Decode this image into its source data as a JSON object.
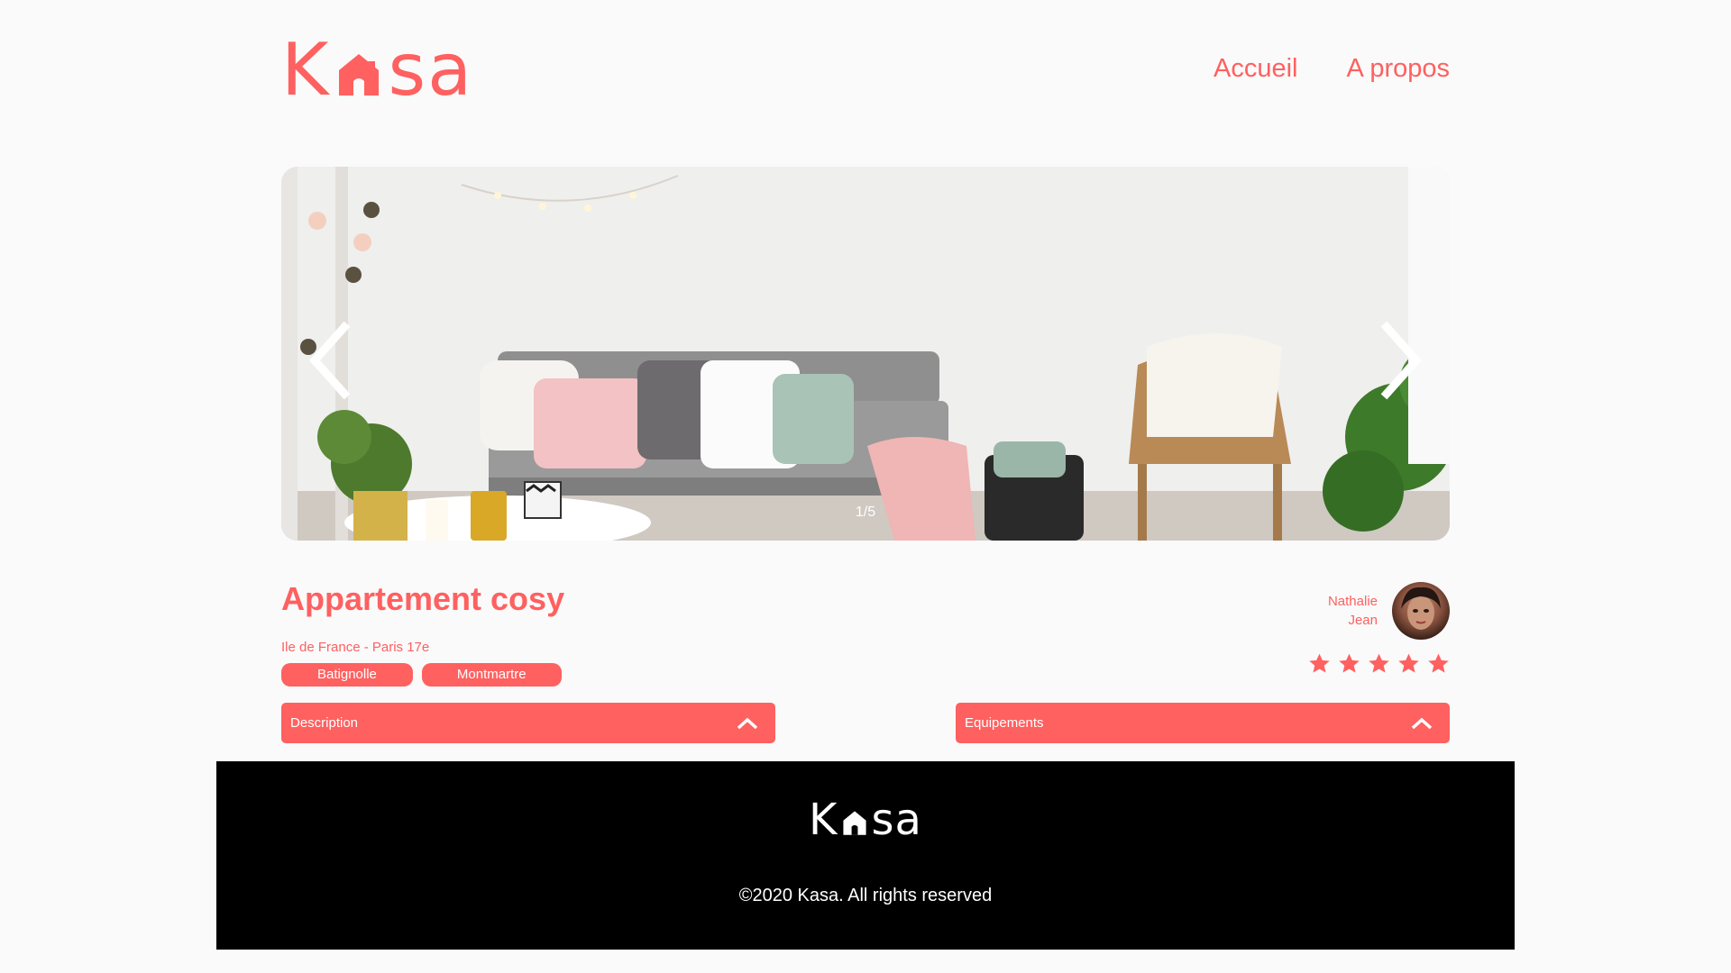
{
  "header": {
    "logo_left": "K",
    "logo_right": "sa",
    "nav": {
      "home": "Accueil",
      "about": "A propos"
    }
  },
  "carousel": {
    "counter": "1/5",
    "prev_icon": "chevron-left-icon",
    "next_icon": "chevron-right-icon"
  },
  "listing": {
    "title": "Appartement cosy",
    "location": "Ile de France - Paris 17e",
    "tags": [
      "Batignolle",
      "Montmartre"
    ],
    "host": {
      "first_name": "Nathalie",
      "last_name": "Jean"
    },
    "rating": 5,
    "rating_max": 5
  },
  "collapses": {
    "description": "Description",
    "equipments": "Equipements"
  },
  "footer": {
    "logo_left": "K",
    "logo_right": "sa",
    "copyright": "©2020 Kasa. All rights reserved"
  },
  "colors": {
    "accent": "#FF6060",
    "footer_bg": "#000000",
    "background": "#FAFAFA"
  }
}
